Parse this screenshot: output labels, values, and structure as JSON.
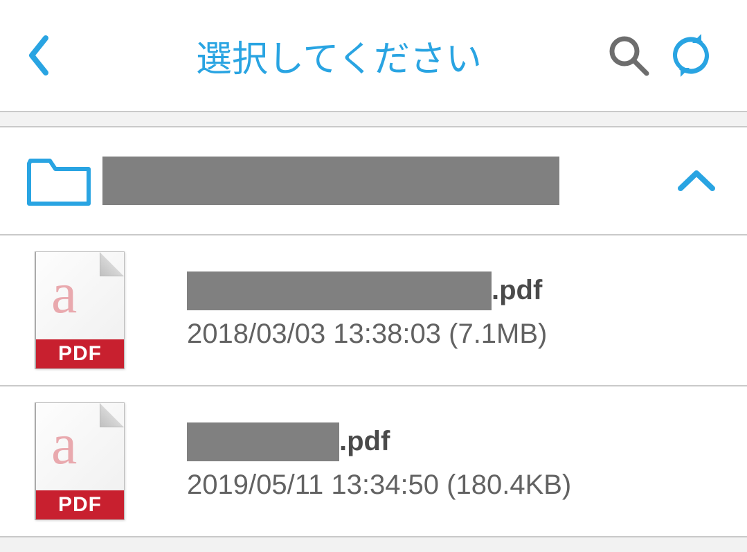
{
  "header": {
    "title": "選択してください"
  },
  "folder": {
    "name_masked": true
  },
  "files": [
    {
      "name_mask_width": 440,
      "ext": ".pdf",
      "meta": "2018/03/03 13:38:03 (7.1MB)",
      "type_label": "PDF"
    },
    {
      "name_mask_width": 220,
      "ext": ".pdf",
      "meta": "2019/05/11 13:34:50 (180.4KB)",
      "type_label": "PDF"
    }
  ]
}
